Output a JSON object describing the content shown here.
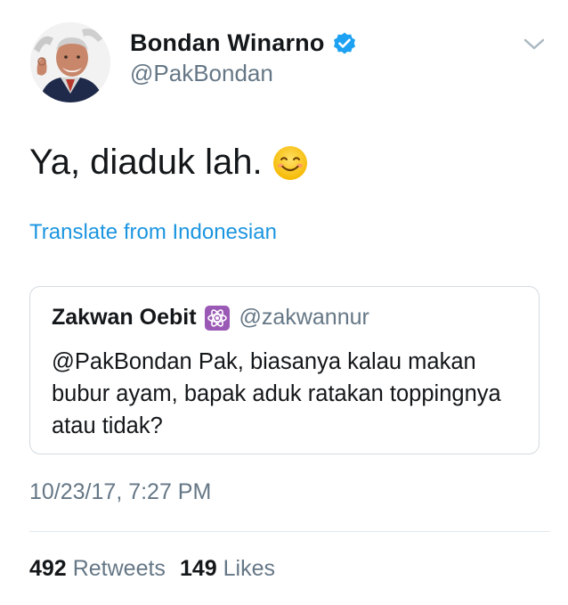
{
  "tweet": {
    "author": {
      "display_name": "Bondan Winarno",
      "handle": "@PakBondan",
      "verified": true,
      "avatar_icon": "avatar-photo"
    },
    "text": "Ya, diaduk lah.",
    "emoji_icon": "smiling-face-emoji",
    "translate_label": "Translate from Indonesian",
    "quoted": {
      "display_name": "Zakwan Oebit",
      "badge_icon": "atom-symbol-emoji",
      "handle": "@zakwannur",
      "text": "@PakBondan Pak, biasanya kalau makan bubur ayam, bapak aduk ratakan toppingnya atau tidak?"
    },
    "timestamp": "10/23/17, 7:27 PM",
    "stats": {
      "retweets_count": "492",
      "retweets_label": "Retweets",
      "likes_count": "149",
      "likes_label": "Likes"
    }
  },
  "colors": {
    "link_blue": "#1b95e0",
    "secondary_gray": "#657786",
    "border_gray": "#d3dbe2",
    "verified_blue": "#1da1f2",
    "atom_purple": "#9b59b6"
  }
}
